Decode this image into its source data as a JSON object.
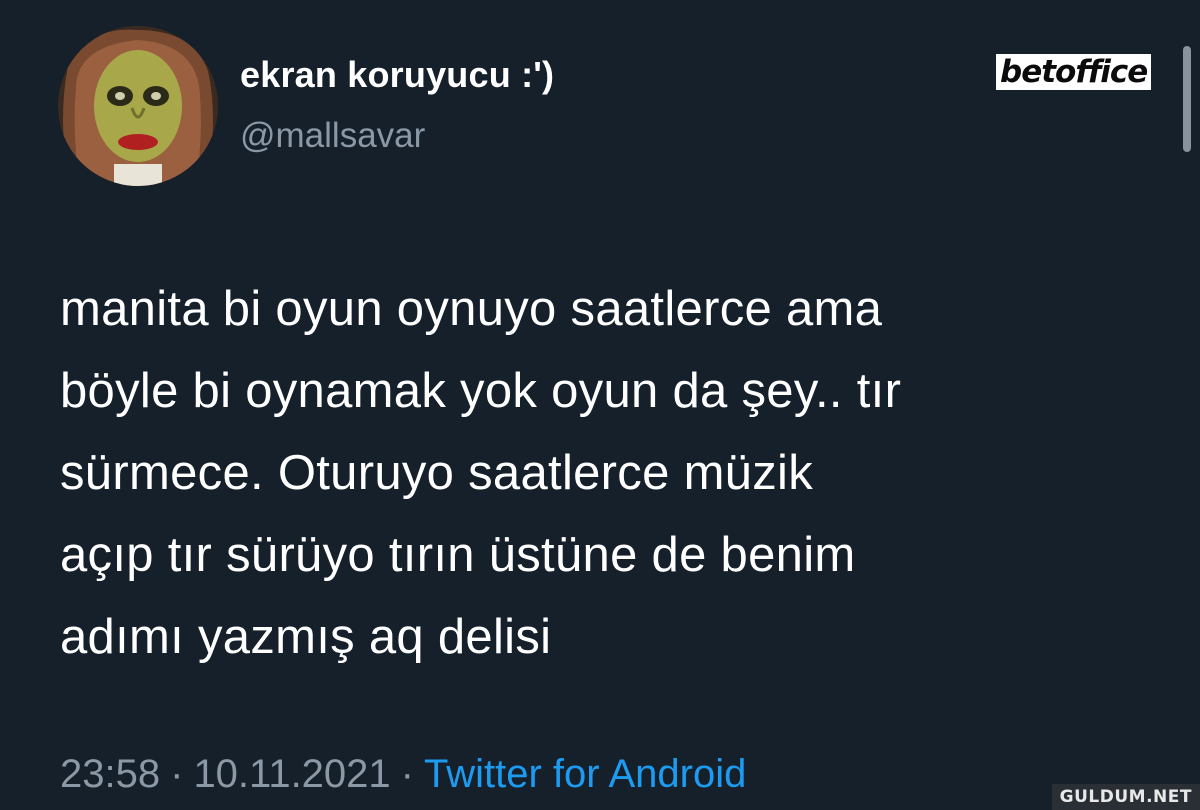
{
  "profile": {
    "display_name": "ekran koruyucu :')",
    "handle": "@mallsavar"
  },
  "brand_badge": "betoffice",
  "tweet": {
    "lines": [
      "manita bi oyun oynuyo saatlerce ama",
      "böyle bi oynamak yok oyun da şey.. tır",
      "sürmece. Oturuyo saatlerce müzik",
      "açıp tır sürüyo tırın üstüne de benim",
      "adımı yazmış aq delisi"
    ],
    "time": "23:58",
    "separator": "·",
    "date": "10.11.2021",
    "source": "Twitter for Android"
  },
  "watermark": "GULDUM.NET",
  "colors": {
    "background": "#15202b",
    "primary_text": "#ffffff",
    "secondary_text": "#8b98a5",
    "link": "#1d9bf0"
  },
  "icons": {
    "avatar": "avatar-image"
  }
}
